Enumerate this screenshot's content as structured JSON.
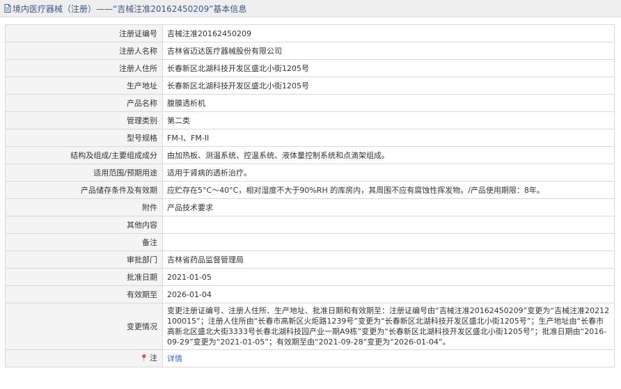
{
  "page": {
    "title": "境内医疗器械（注册）——“吉械注准20162450209”基本信息"
  },
  "rows": [
    {
      "label": "注册证编号",
      "value": "吉械注准20162450209"
    },
    {
      "label": "注册人名称",
      "value": "吉林省迈达医疗器械股份有限公司"
    },
    {
      "label": "注册人住所",
      "value": "长春新区北湖科技开发区盛北小街1205号"
    },
    {
      "label": "生产地址",
      "value": "长春新区北湖科技开发区盛北小街1205号"
    },
    {
      "label": "产品名称",
      "value": "腹膜透析机"
    },
    {
      "label": "管理类别",
      "value": "第二类"
    },
    {
      "label": "型号规格",
      "value": "FM-I、FM-II"
    },
    {
      "label": "结构及组成/主要组成成分",
      "value": "由加热板、测温系统、控温系统、液体量控制系统和点滴架组成。"
    },
    {
      "label": "适用范围/预期用途",
      "value": "适用于肾病的透析治疗。"
    },
    {
      "label": "产品储存条件及有效期",
      "value": "应贮存在5°C～40°C，相对湿度不大于90%RH 的库房内，其周围不应有腐蚀性挥发物。/产品使用期限：8年。"
    },
    {
      "label": "附件",
      "value": "产品技术要求"
    },
    {
      "label": "其他内容",
      "value": ""
    },
    {
      "label": "备注",
      "value": ""
    },
    {
      "label": "审批部门",
      "value": "吉林省药品监督管理局"
    },
    {
      "label": "批准日期",
      "value": "2021-01-05"
    },
    {
      "label": "有效期至",
      "value": "2026-01-04"
    },
    {
      "label": "变更情况",
      "value": "变更注册证编号、注册人住所、生产地址、批准日期和有效期至：注册证编号由“吉械注准20162450209”变更为“吉械注准20212100015”；注册人住所由“长春市高新区火炬路1239号”变更为“长春新区北湖科技开发区盛北小街1205号”；生产地址由“长春市高新北区盛北大街3333号长春北湖科技园产业一期A9栋”变更为“长春新区北湖科技开发区盛北小街1205号”；批准日期由“2016-09-29”变更为“2021-01-05”；有效期至由“2021-09-28”变更为“2026-01-04”。"
    },
    {
      "label": "注",
      "value": "详情"
    }
  ],
  "icons": {
    "title": "document-icon",
    "note": "pin-icon"
  },
  "colors": {
    "title_text": "#3b5a8a",
    "label_bg": "#f4f4f4",
    "link": "#3366cc"
  }
}
